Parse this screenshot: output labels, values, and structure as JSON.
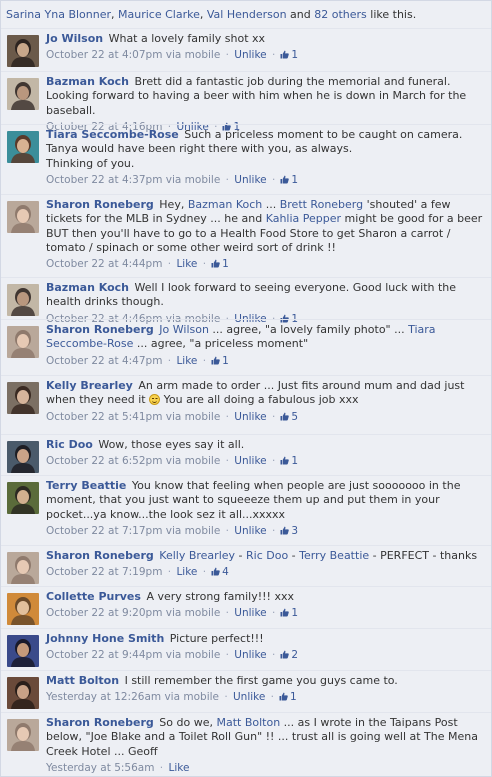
{
  "likes_bar": {
    "names": [
      "Sarina Yna Blonner",
      "Maurice Clarke",
      "Val Henderson"
    ],
    "sep1": ", ",
    "sep2": ", ",
    "and_text": " and ",
    "others": "82 others",
    "suffix": " like this."
  },
  "comments": [
    {
      "author": "Jo Wilson",
      "text": "What a lovely family shot xx",
      "time": "October 22 at 4:07pm",
      "via": "via mobile",
      "action": "Unlike",
      "likes": "1",
      "avatar_colors": [
        "#6b5a4a",
        "#c8a78a",
        "#2d2420"
      ]
    },
    {
      "author": "Bazman Koch",
      "text": "Brett did a fantastic job during the memorial and funeral. Looking forward to having a beer with him when he is down in March for the baseball.",
      "time": "October 22 at 4:16pm",
      "via": "",
      "action": "Unlike",
      "likes": "1",
      "avatar_colors": [
        "#c2b7a6",
        "#b9977e",
        "#403631"
      ]
    },
    {
      "author": "Tiara Seccombe-Rose",
      "text": "Such a priceless moment to be caught on camera. Tanya would have been right there with you, as always.",
      "text2": "Thinking of you.",
      "time": "October 22 at 4:37pm",
      "via": "via mobile",
      "action": "Unlike",
      "likes": "1",
      "avatar_colors": [
        "#3b8e9a",
        "#d8b292",
        "#5a3a2a"
      ]
    },
    {
      "author": "Sharon Roneberg",
      "text_parts": [
        {
          "t": "Hey, ",
          "link": false
        },
        {
          "t": "Bazman Koch",
          "link": true
        },
        {
          "t": " ... ",
          "link": false
        },
        {
          "t": "Brett Roneberg",
          "link": true
        },
        {
          "t": " 'shouted' a few tickets for the MLB in Sydney ... he and ",
          "link": false
        },
        {
          "t": "Kahlia Pepper",
          "link": true
        },
        {
          "t": " might be good for a beer BUT then you'll have to go to a Health Food Store to get Sharon a carrot / tomato / spinach or some other weird sort of drink !!",
          "link": false
        }
      ],
      "time": "October 22 at 4:44pm",
      "via": "",
      "action": "Like",
      "likes": "1",
      "avatar_colors": [
        "#b9a89a",
        "#e6c9b4",
        "#8f7a6d"
      ]
    },
    {
      "author": "Bazman Koch",
      "text": "Well I look forward to seeing everyone. Good luck with the health drinks though.",
      "time": "October 22 at 4:46pm",
      "via": "via mobile",
      "action": "Unlike",
      "likes": "1",
      "avatar_colors": [
        "#c2b7a6",
        "#b9977e",
        "#403631"
      ]
    },
    {
      "author": "Sharon Roneberg",
      "text_parts": [
        {
          "t": "Jo Wilson",
          "link": true
        },
        {
          "t": " ... agree, \"a lovely family photo\" ... ",
          "link": false
        },
        {
          "t": "Tiara Seccombe-Rose",
          "link": true
        },
        {
          "t": " ... agree, \"a priceless moment\"",
          "link": false
        }
      ],
      "time": "October 22 at 4:47pm",
      "via": "",
      "action": "Like",
      "likes": "1",
      "avatar_colors": [
        "#b9a89a",
        "#e6c9b4",
        "#8f7a6d"
      ]
    },
    {
      "author": "Kelly Brearley",
      "text": "An arm made to order ... Just fits around mum and dad just when they need it",
      "text_after_smiley": " You are all doing a fabulous job xxx",
      "time": "October 22 at 5:41pm",
      "via": "via mobile",
      "action": "Unlike",
      "likes": "5",
      "avatar_colors": [
        "#7b6f63",
        "#d6b49b",
        "#3a2a22"
      ]
    },
    {
      "author": "Ric Doo",
      "text": "Wow, those eyes say it all.",
      "time": "October 22 at 6:52pm",
      "via": "via mobile",
      "action": "Unlike",
      "likes": "1",
      "avatar_colors": [
        "#4a5a6a",
        "#caa388",
        "#1e1e24"
      ]
    },
    {
      "author": "Terry Beattie",
      "text": "You know that feeling when people are just sooooooo in the moment, that you just want to squeeeze them up and put them in your pocket...ya know...the look sez it all...xxxxx",
      "time": "October 22 at 7:17pm",
      "via": "via mobile",
      "action": "Unlike",
      "likes": "3",
      "avatar_colors": [
        "#5a6b3a",
        "#d1b08f",
        "#2c2a22"
      ]
    },
    {
      "author": "Sharon Roneberg",
      "text_parts": [
        {
          "t": "Kelly Brearley",
          "link": true
        },
        {
          "t": " - ",
          "link": false
        },
        {
          "t": "Ric Doo",
          "link": true
        },
        {
          "t": " - ",
          "link": false
        },
        {
          "t": "Terry Beattie",
          "link": true
        },
        {
          "t": " - PERFECT - thanks",
          "link": false
        }
      ],
      "time": "October 22 at 7:19pm",
      "via": "",
      "action": "Like",
      "likes": "4",
      "avatar_colors": [
        "#b9a89a",
        "#e6c9b4",
        "#8f7a6d"
      ]
    },
    {
      "author": "Collette Purves",
      "text": "A very strong family!!! xxx",
      "time": "October 22 at 9:20pm",
      "via": "via mobile",
      "action": "Unlike",
      "likes": "1",
      "avatar_colors": [
        "#d08a3a",
        "#e2c09c",
        "#6a4a2a"
      ]
    },
    {
      "author": "Johnny Hone Smith",
      "text": "Picture perfect!!!",
      "time": "October 22 at 9:44pm",
      "via": "via mobile",
      "action": "Unlike",
      "likes": "2",
      "avatar_colors": [
        "#3a4a8a",
        "#c59a7a",
        "#1a1a2a"
      ]
    },
    {
      "author": "Matt Bolton",
      "text": "I still remember the first game you guys came to.",
      "time": "Yesterday at 12:26am",
      "via": "via mobile",
      "action": "Unlike",
      "likes": "1",
      "avatar_colors": [
        "#6a4a3a",
        "#c9a287",
        "#2a1f1a"
      ]
    },
    {
      "author": "Sharon Roneberg",
      "text_parts": [
        {
          "t": "So do we, ",
          "link": false
        },
        {
          "t": "Matt Bolton",
          "link": true
        },
        {
          "t": " ... as I wrote in the Taipans Post below, \"Joe Blake and a Toilet Roll Gun\" !! ... trust all is going well at The Mena Creek Hotel ... Geoff",
          "link": false
        }
      ],
      "time": "Yesterday at 5:56am",
      "via": "",
      "action": "Like",
      "likes": "",
      "avatar_colors": [
        "#b9a89a",
        "#e6c9b4",
        "#8f7a6d"
      ]
    }
  ],
  "colors": {
    "link": "#3b5998",
    "meta": "#7f8aa0",
    "background": "#edeff4",
    "border": "#e2e5ed"
  },
  "icons": {
    "thumb": "thumbs-up-icon",
    "smiley": "smiley-icon"
  }
}
